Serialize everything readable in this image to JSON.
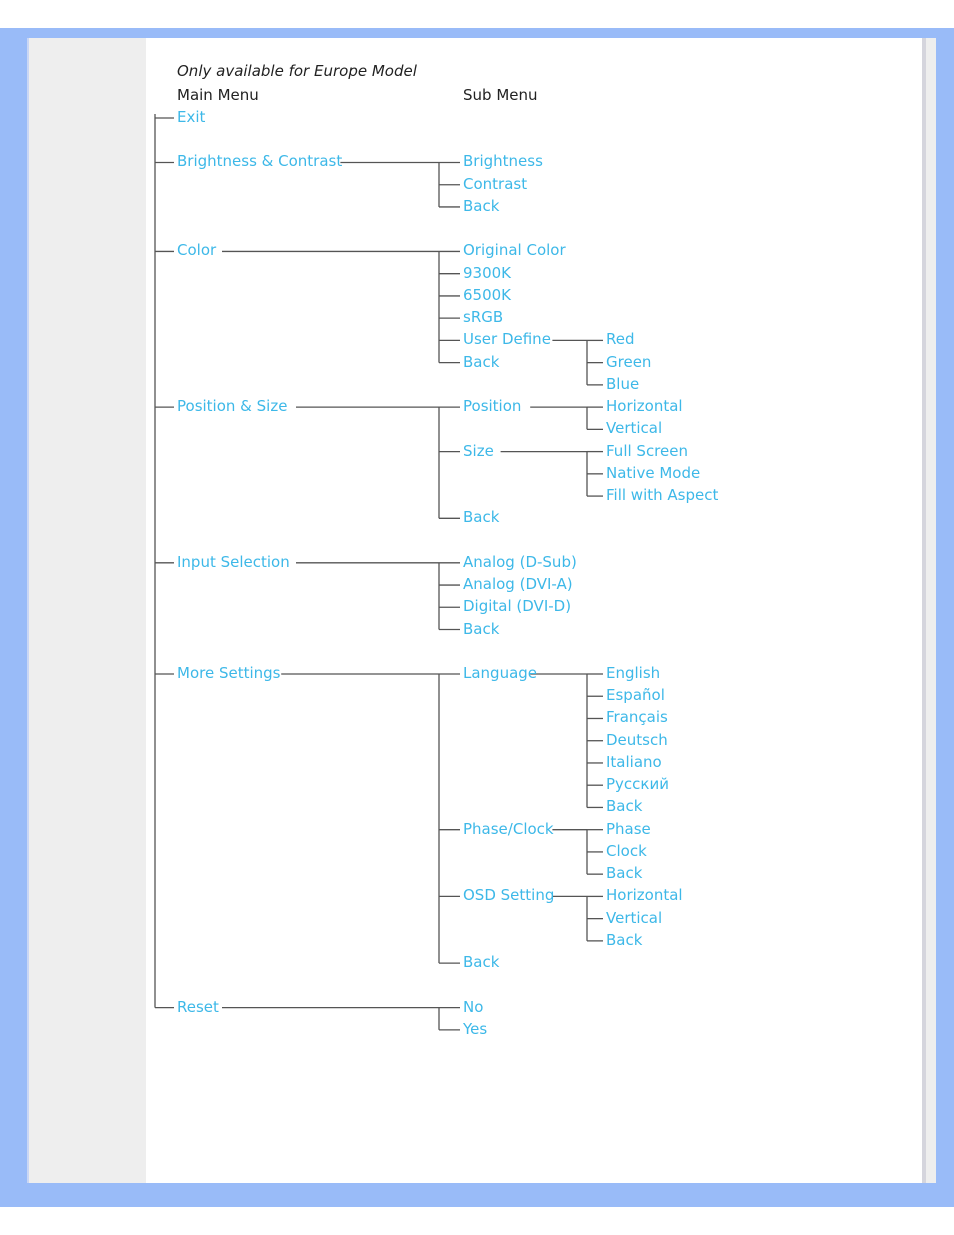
{
  "header": {
    "note": "Only available for Europe Model",
    "main_menu_label": "Main Menu",
    "sub_menu_label": "Sub Menu"
  },
  "colors": {
    "frame": "#99bbf8",
    "label": "#3db8e8",
    "line": "#555555"
  },
  "menu": [
    {
      "label": "Exit",
      "row": 0,
      "children": []
    },
    {
      "label": "Brightness & Contrast",
      "row": 2,
      "children": [
        {
          "label": "Brightness",
          "row": 2
        },
        {
          "label": "Contrast",
          "row": 3
        },
        {
          "label": "Back",
          "row": 4
        }
      ]
    },
    {
      "label": "Color",
      "row": 6,
      "children": [
        {
          "label": "Original Color",
          "row": 6
        },
        {
          "label": "9300K",
          "row": 7
        },
        {
          "label": "6500K",
          "row": 8
        },
        {
          "label": "sRGB",
          "row": 9
        },
        {
          "label": "User Define",
          "row": 10,
          "children": [
            {
              "label": "Red",
              "row": 10
            },
            {
              "label": "Green",
              "row": 11
            },
            {
              "label": "Blue",
              "row": 12
            }
          ]
        },
        {
          "label": "Back",
          "row": 11
        }
      ]
    },
    {
      "label": "Position & Size",
      "row": 13,
      "children": [
        {
          "label": "Position",
          "row": 13,
          "children": [
            {
              "label": "Horizontal",
              "row": 13
            },
            {
              "label": "Vertical",
              "row": 14
            }
          ]
        },
        {
          "label": "Size",
          "row": 15,
          "children": [
            {
              "label": "Full Screen",
              "row": 15
            },
            {
              "label": "Native Mode",
              "row": 16
            },
            {
              "label": "Fill with Aspect",
              "row": 17
            }
          ]
        },
        {
          "label": "Back",
          "row": 18
        }
      ]
    },
    {
      "label": "Input Selection",
      "row": 20,
      "children": [
        {
          "label": "Analog (D-Sub)",
          "row": 20
        },
        {
          "label": "Analog (DVI-A)",
          "row": 21
        },
        {
          "label": "Digital (DVI-D)",
          "row": 22
        },
        {
          "label": "Back",
          "row": 23
        }
      ]
    },
    {
      "label": "More Settings",
      "row": 25,
      "children": [
        {
          "label": "Language",
          "row": 25,
          "children": [
            {
              "label": "English",
              "row": 25
            },
            {
              "label": "Español",
              "row": 26
            },
            {
              "label": "Français",
              "row": 27
            },
            {
              "label": "Deutsch",
              "row": 28
            },
            {
              "label": "Italiano",
              "row": 29
            },
            {
              "label": "Русский",
              "row": 30
            },
            {
              "label": "Back",
              "row": 31
            }
          ]
        },
        {
          "label": "Phase/Clock",
          "row": 32,
          "children": [
            {
              "label": "Phase",
              "row": 32
            },
            {
              "label": "Clock",
              "row": 33
            },
            {
              "label": "Back",
              "row": 34
            }
          ]
        },
        {
          "label": "OSD Setting",
          "row": 35,
          "children": [
            {
              "label": "Horizontal",
              "row": 35
            },
            {
              "label": "Vertical",
              "row": 36
            },
            {
              "label": "Back",
              "row": 37
            }
          ]
        },
        {
          "label": "Back",
          "row": 38
        }
      ]
    },
    {
      "label": "Reset",
      "row": 40,
      "children": [
        {
          "label": "No",
          "row": 40
        },
        {
          "label": "Yes",
          "row": 41
        }
      ]
    }
  ]
}
